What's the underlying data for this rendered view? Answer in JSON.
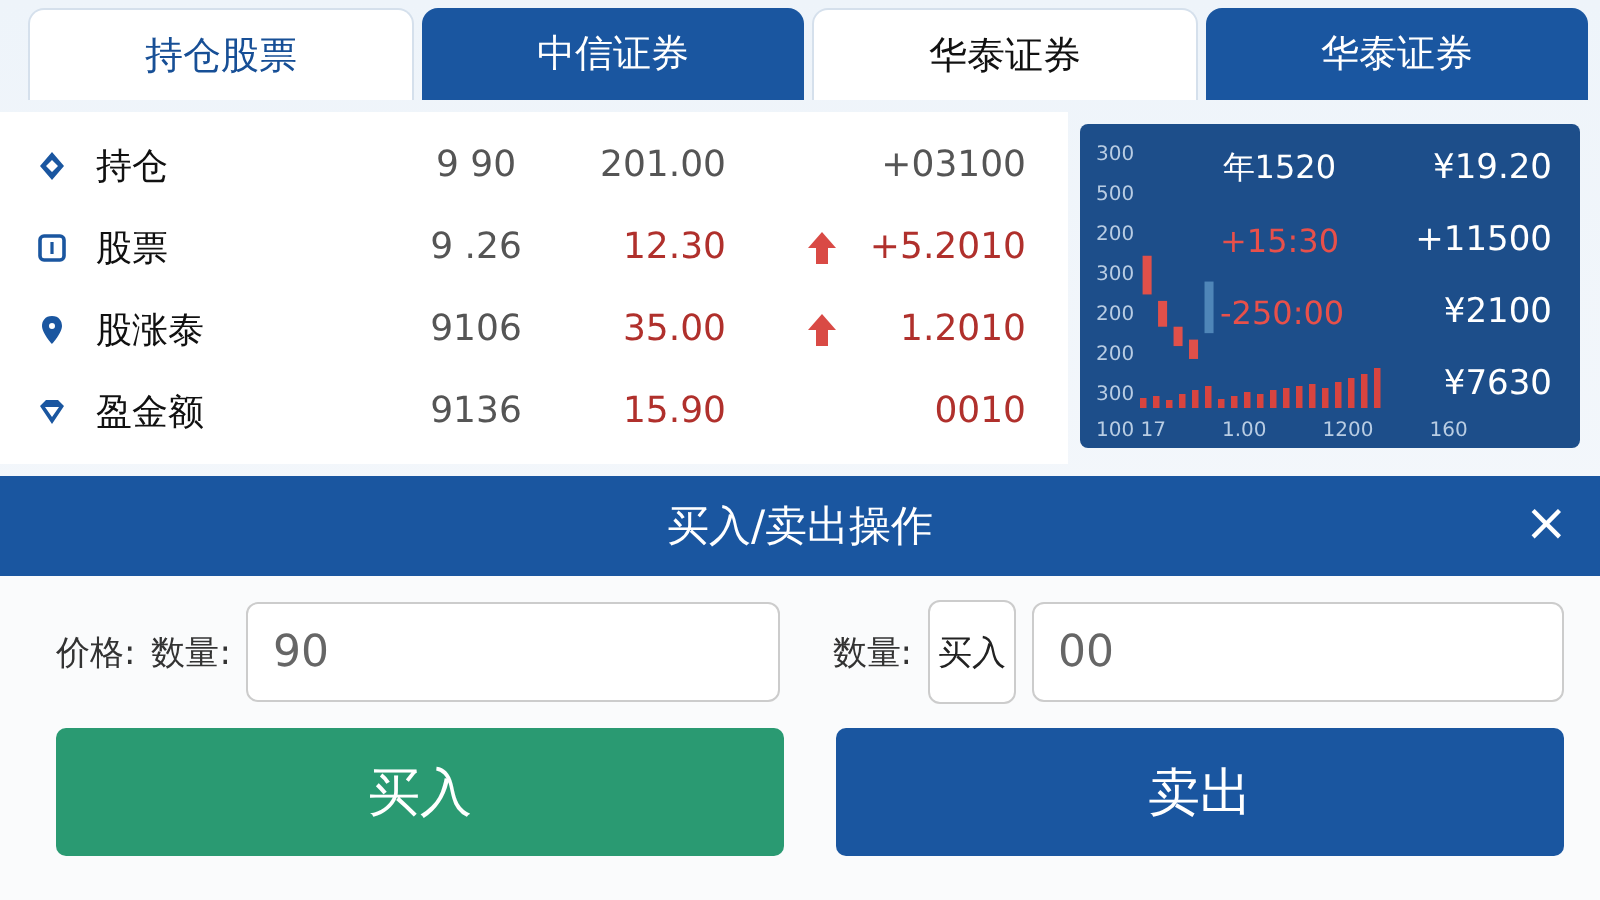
{
  "tabs": [
    {
      "label": "持仓股票",
      "selected": true
    },
    {
      "label": "中信证券",
      "selected": false
    },
    {
      "label": "华泰证券",
      "selected": true
    },
    {
      "label": "华泰证券",
      "selected": false
    }
  ],
  "holdings": [
    {
      "name": "持仓",
      "col_2": "9  90",
      "col_3": "201.00",
      "col_4": "+03100",
      "red": false
    },
    {
      "name": "股票",
      "col_2": "9 .26",
      "col_3": "12.30",
      "col_4": "+5.2010",
      "up": true,
      "red": true
    },
    {
      "name": "股涨泰",
      "col_2": "9106",
      "col_3": "35.00",
      "col_4": "1.2010",
      "up": true,
      "red": true
    },
    {
      "name": "盈金额",
      "col_2": "9136",
      "col_3": "15.90",
      "col_4": "0010",
      "red": true
    }
  ],
  "chart_panel": {
    "y_labels": [
      "300",
      "500",
      "200",
      "300",
      "200",
      "200",
      "300"
    ],
    "x_labels": [
      "100 17",
      "1.00",
      "1200",
      "160"
    ],
    "readings": [
      {
        "left": {
          "text": "年1520",
          "red": false
        },
        "right": {
          "text": "¥19.20",
          "red": false
        }
      },
      {
        "left": {
          "text": "+15:30",
          "red": true
        },
        "right": {
          "text": "+11500",
          "red": false
        }
      },
      {
        "left": {
          "text": "-250:00",
          "red": true
        },
        "right": {
          "text": "¥2100",
          "red": false
        }
      },
      {
        "right": {
          "text": "¥7630",
          "red": false
        }
      }
    ]
  },
  "dialog": {
    "title": "买入/卖出操作",
    "close": "×",
    "price_label": "价格:",
    "quantity_label": "数量:",
    "quantity_value": "90",
    "quantity_label_2": "数量:",
    "mode_button": "买入",
    "amount_value": "00",
    "buy_button": "买入",
    "sell_button": "卖出"
  }
}
